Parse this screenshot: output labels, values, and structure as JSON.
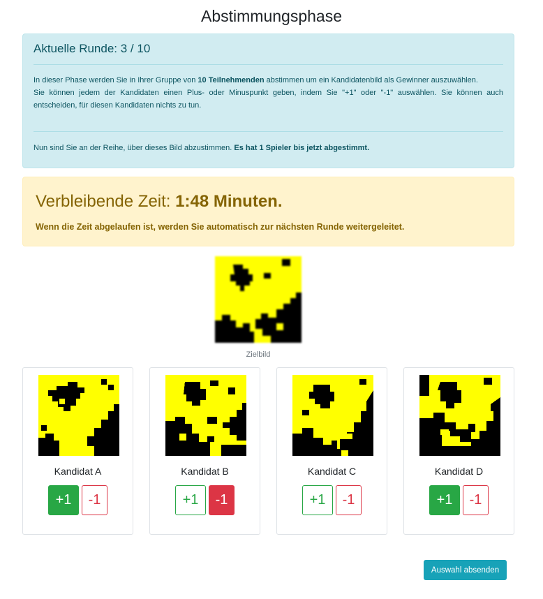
{
  "page": {
    "title": "Abstimmungsphase"
  },
  "info": {
    "heading": "Aktuelle Runde: 3 / 10",
    "text_pre": "In dieser Phase werden Sie in Ihrer Gruppe von ",
    "text_bold": "10 Teilnehmenden",
    "text_post": " abstimmen um ein Kandidatenbild als Gewinner auszuwählen.",
    "text_line2": "Sie können jedem der Kandidaten einen Plus- oder Minuspunkt geben, indem Sie \"+1\" oder \"-1\" auswählen. Sie können auch entscheiden, für diesen Kandidaten nichts zu tun.",
    "footer_pre": "Nun sind Sie an der Reihe, über dieses Bild abzustimmen. ",
    "footer_bold": "Es hat 1 Spieler bis jetzt abgestimmt."
  },
  "timer": {
    "label": "Verbleibende Zeit: ",
    "value": "1:48 Minuten.",
    "note": "Wenn die Zeit abgelaufen ist, werden Sie automatisch zur nächsten Runde weitergeleitet."
  },
  "target": {
    "caption": "Zielbild"
  },
  "candidates": [
    {
      "name": "Kandidat A",
      "plus_label": "+1",
      "minus_label": "-1",
      "vote": "+1"
    },
    {
      "name": "Kandidat B",
      "plus_label": "+1",
      "minus_label": "-1",
      "vote": "-1"
    },
    {
      "name": "Kandidat C",
      "plus_label": "+1",
      "minus_label": "-1",
      "vote": ""
    },
    {
      "name": "Kandidat D",
      "plus_label": "+1",
      "minus_label": "-1",
      "vote": "+1"
    }
  ],
  "submit": {
    "label": "Auswahl absenden"
  },
  "colors": {
    "pattern_yellow": "#ffff00",
    "pattern_black": "#000000",
    "success": "#28a745",
    "danger": "#dc3545",
    "info_button": "#17a2b8"
  }
}
